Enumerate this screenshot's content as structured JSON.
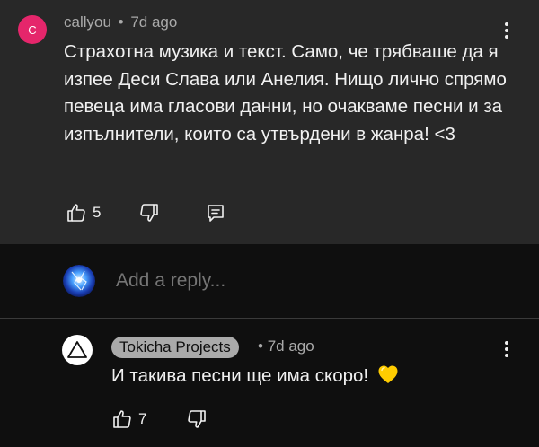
{
  "top_comment": {
    "avatar_letter": "C",
    "author": "callyou",
    "separator": "•",
    "time": "7d ago",
    "text": "Страхотна музика и текст. Само, че трябваше да я изпее Деси Слава или Анелия. Нищо лично спрямо певеца има гласови данни, но очакваме песни и за изпълнители, които са утвърдени в жанра! <3",
    "like_count": "5",
    "icons": [
      "like-icon",
      "dislike-icon",
      "reply-icon",
      "more-vert-icon"
    ]
  },
  "reply_box": {
    "placeholder": "Add a reply..."
  },
  "reply": {
    "author": "Tokicha Projects",
    "separator": "•",
    "time": "7d ago",
    "text": "И такива песни ще има скоро!",
    "emoji": "yellow-heart",
    "like_count": "7",
    "icons": [
      "like-icon",
      "dislike-icon",
      "more-vert-icon",
      "triangle-logo-icon"
    ]
  },
  "colors": {
    "comment_bg": "#282828",
    "page_bg": "#0f0f0f",
    "avatar_c": "#e5266b",
    "muted_text": "#aaaaaa",
    "chip_bg": "#aaaaaa",
    "heart": "#ffcc00"
  }
}
